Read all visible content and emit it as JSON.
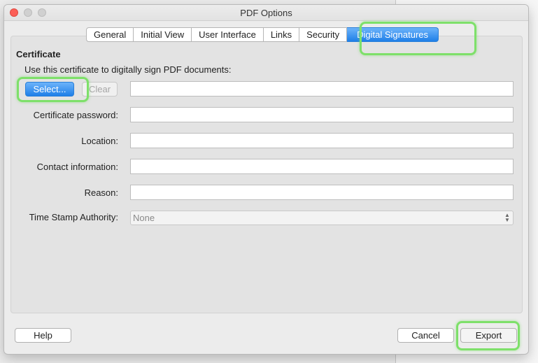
{
  "window": {
    "title": "PDF Options"
  },
  "tabs": [
    {
      "label": "General",
      "active": false
    },
    {
      "label": "Initial View",
      "active": false
    },
    {
      "label": "User Interface",
      "active": false
    },
    {
      "label": "Links",
      "active": false
    },
    {
      "label": "Security",
      "active": false
    },
    {
      "label": "Digital Signatures",
      "active": true
    }
  ],
  "certificate": {
    "section_title": "Certificate",
    "description": "Use this certificate to digitally sign PDF documents:",
    "select_label": "Select...",
    "clear_label": "Clear",
    "certificate_value": ""
  },
  "fields": {
    "password_label": "Certificate password:",
    "password_value": "",
    "location_label": "Location:",
    "location_value": "",
    "contact_label": "Contact information:",
    "contact_value": "",
    "reason_label": "Reason:",
    "reason_value": "",
    "tsa_label": "Time Stamp Authority:",
    "tsa_selected": "None"
  },
  "footer": {
    "help_label": "Help",
    "cancel_label": "Cancel",
    "export_label": "Export"
  },
  "colors": {
    "accent_blue": "#1f7fe8",
    "highlight_green": "#7ee06a",
    "close_red": "#fc5f57"
  },
  "icons": {
    "close": "traffic-close",
    "minimize": "traffic-minimize",
    "maximize": "traffic-maximize",
    "combo": "up-down-arrows"
  }
}
